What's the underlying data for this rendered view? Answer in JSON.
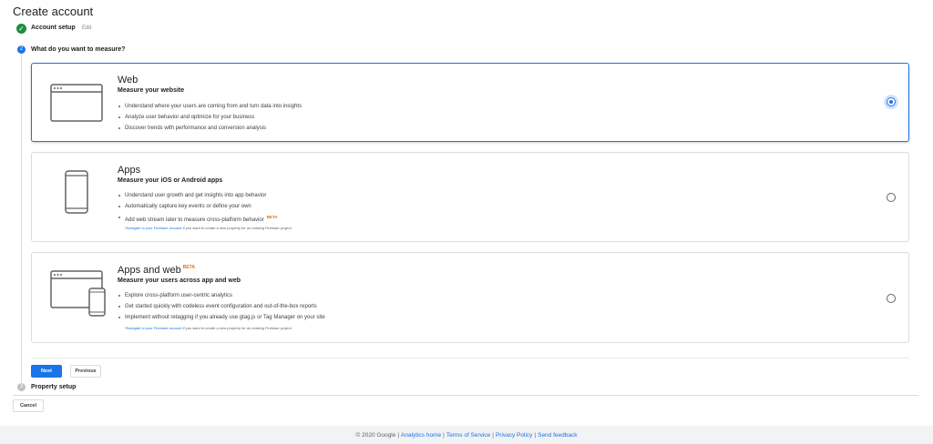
{
  "page": {
    "title": "Create account"
  },
  "steps": [
    {
      "number": "",
      "label": "Account setup",
      "action": "Edit"
    },
    {
      "number": "2",
      "label": "What do you want to measure?"
    },
    {
      "number": "3",
      "label": "Property setup"
    }
  ],
  "options": [
    {
      "title": "Web",
      "subtitle": "Measure your website",
      "bullets": [
        "Understand where your users are coming from and turn data into insights",
        "Analyze user behavior and optimize for your business",
        "Discover trends with performance and conversion analysis"
      ],
      "selected": true,
      "icon": "browser-window-icon"
    },
    {
      "title": "Apps",
      "subtitle": "Measure your iOS or Android apps",
      "bullets": [
        "Understand user growth and get insights into app behavior",
        "Automatically capture key events or define your own",
        "Add web stream later to measure cross-platform behavior"
      ],
      "badge": "BETA",
      "note_link": "*Navigate to your Firebase account",
      "note_text": " if you want to create a new property for an existing Firebase project",
      "selected": false,
      "icon": "smartphone-icon"
    },
    {
      "title": "Apps and web",
      "title_badge": "BETA",
      "subtitle": "Measure your users across app and web",
      "bullets": [
        "Explore cross-platform user-centric analytics",
        "Get started quickly with codeless event configuration and out-of-the-box reports",
        "Implement without retagging if you already use gtag.js or Tag Manager on your site"
      ],
      "note_link": "*Navigate to your Firebase account",
      "note_text": " if you want to create a new property for an existing Firebase project",
      "selected": false,
      "icon": "browser-and-phone-icon"
    }
  ],
  "buttons": {
    "next": "Next",
    "previous": "Previous",
    "cancel": "Cancel"
  },
  "footer": {
    "copyright": "© 2020 Google",
    "separator": "|",
    "links": [
      "Analytics home",
      "Terms of Service",
      "Privacy Policy",
      "Send feedback"
    ]
  },
  "colors": {
    "primary": "#1a73e8",
    "success": "#1e8e3e",
    "beta": "#e8710a",
    "border": "#dadce0"
  }
}
